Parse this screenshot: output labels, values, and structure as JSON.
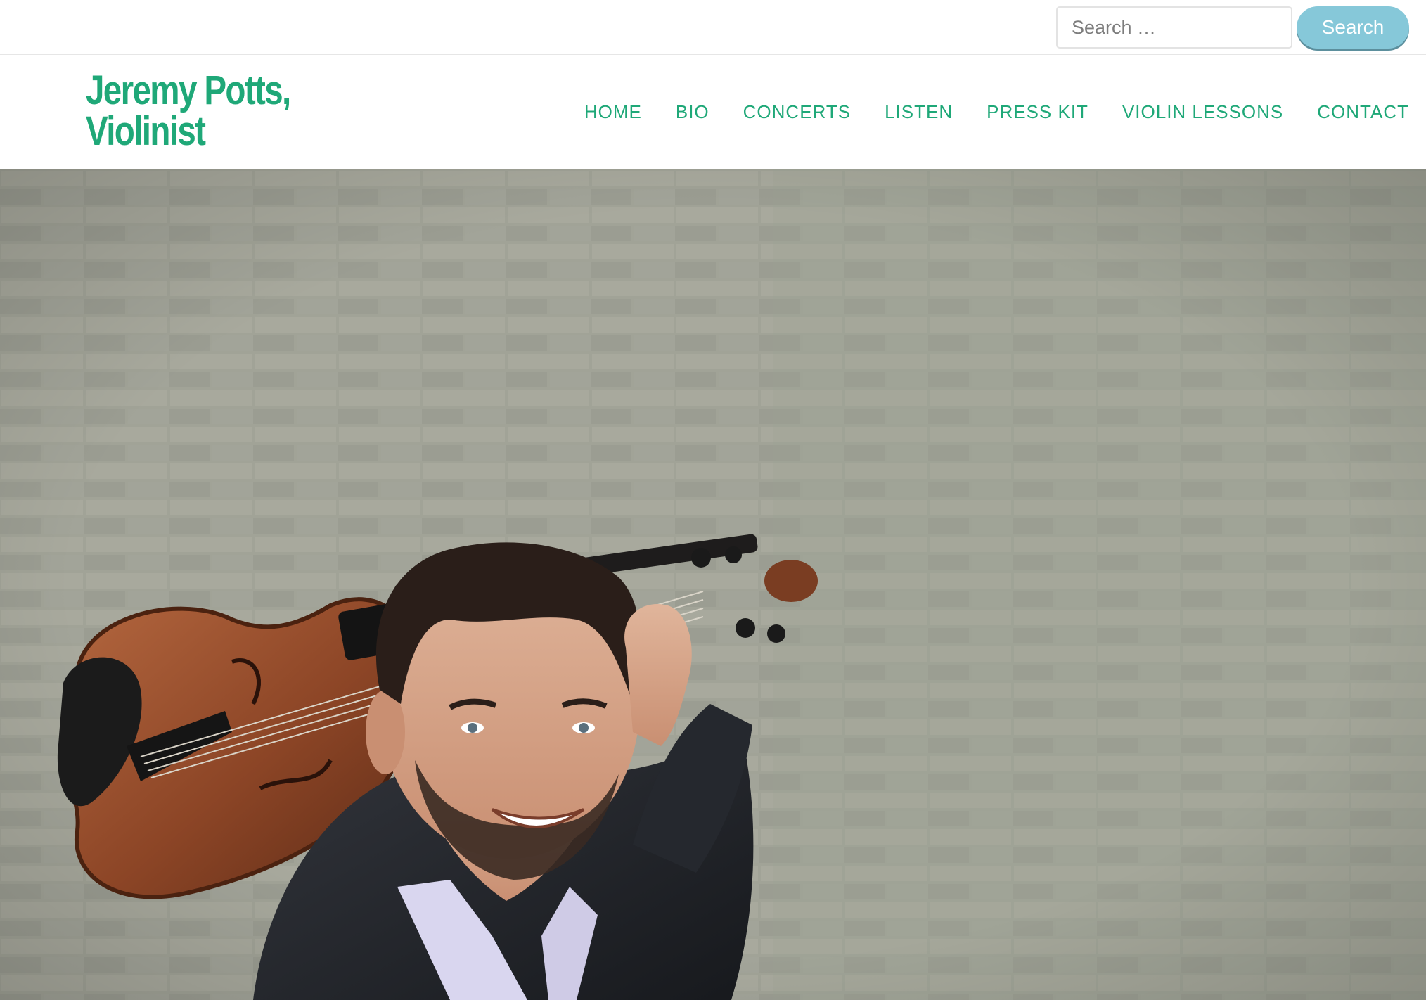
{
  "search": {
    "placeholder": "Search …",
    "button_label": "Search"
  },
  "site": {
    "title_line1": "Jeremy Potts,",
    "title_line2": "Violinist"
  },
  "nav": {
    "items": [
      {
        "label": "HOME"
      },
      {
        "label": "BIO"
      },
      {
        "label": "CONCERTS"
      },
      {
        "label": "LISTEN"
      },
      {
        "label": "PRESS KIT"
      },
      {
        "label": "VIOLIN LESSONS"
      },
      {
        "label": "CONTACT"
      }
    ]
  },
  "colors": {
    "brand_green": "#1fa878",
    "search_button": "#86c8d9"
  },
  "hero": {
    "image_subject": "violinist-portrait-photo"
  }
}
